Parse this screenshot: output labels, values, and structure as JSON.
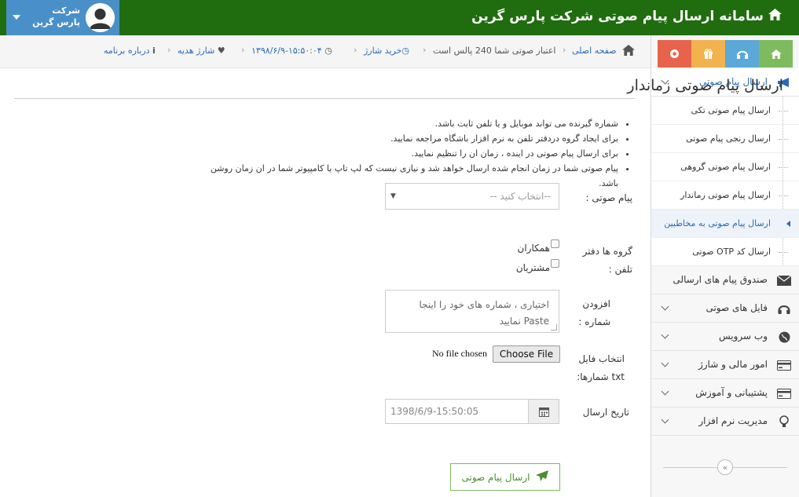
{
  "header": {
    "title": "سامانه ارسال پیام صوتی شرکت پارس گرین",
    "user_line1": "شرکت",
    "user_line2": "پارس گرین"
  },
  "breadcrumb": {
    "home": "صفحه اصلی",
    "credit": "اعتبار صوتی شما 240 پالس است",
    "buy": "خرید شارژ",
    "datetime": "۱۳۹۸/۶/۹-۱۵:۵۰:۰۴",
    "gift": "شارژ هدیه",
    "about": "درباره برنامه"
  },
  "sidebar": {
    "menu": [
      {
        "label": "ارسال پیام صوتی"
      },
      {
        "label": "صندوق پیام های ارسالی"
      },
      {
        "label": "فایل های صوتی"
      },
      {
        "label": "وب سرویس"
      },
      {
        "label": "امور مالی و شارژ"
      },
      {
        "label": "پشتیبانی و آموزش"
      },
      {
        "label": "مدیریت نرم افزار"
      }
    ],
    "submenu": [
      {
        "label": "ارسال پیام صوتی تکی"
      },
      {
        "label": "ارسال رنجی پیام صوتی"
      },
      {
        "label": "ارسال پیام صوتی گروهی"
      },
      {
        "label": "ارسال پیام صوتی زماندار"
      },
      {
        "label": "ارسال پیام صوتی به مخاطبین"
      },
      {
        "label": "ارسال کد OTP صوتی"
      }
    ]
  },
  "main": {
    "title": "ارسال پیام صوتی زماندار",
    "notes": [
      "شماره گیرنده می تواند موبایل و یا تلفن ثابت باشد.",
      "برای ایجاد گروه  دردفتر تلفن  به نرم افزار باشگاه مراجعه نمایید.",
      "برای ارسال پیام صوتی در اینده ، زمان ان را تنظیم نمایید.",
      "پیام صوتی شما در زمان انجام شده ارسال خواهد شد و نیازی نیست که لپ تاپ یا کامپیوتر شما در ان زمان روشن باشد."
    ],
    "voice_label": "پیام صوتی :",
    "voice_select": "--انتخاب کنید --",
    "groups_label_1": "گروه ها دفتر",
    "groups_label_2": "تلفن :",
    "group_1": "همکاران",
    "group_2": "مشتریان",
    "add_label_1": "افزودن",
    "add_label_2": "شماره :",
    "numbers_placeholder_1": "اختیاری ، شماره های خود را اینجا",
    "numbers_placeholder_2": "Paste نمایید",
    "file_label_1": "انتخاب فایل",
    "file_label_2": "txt شمارها:",
    "file_button": "Choose File",
    "file_none": "No file chosen",
    "date_label": "تاریخ ارسال",
    "date_value": "1398/6/9-15:50:05",
    "send_button": "ارسال پیام صوتی"
  },
  "colors": {
    "header_bg": "#1f6d0e",
    "user_bg": "#4a90c8",
    "link": "#2a6bb5",
    "accent_green": "#7dbb5e"
  }
}
